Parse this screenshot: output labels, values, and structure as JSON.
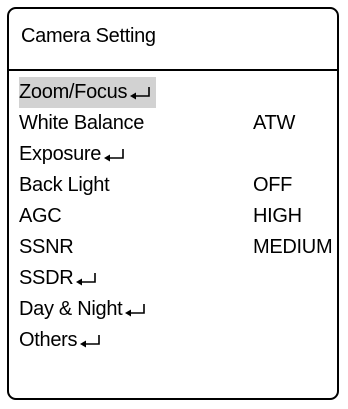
{
  "title": "Camera Setting",
  "menu": [
    {
      "label": "Zoom/Focus",
      "value": "",
      "submenu": true,
      "highlighted": true
    },
    {
      "label": "White Balance",
      "value": "ATW",
      "submenu": false,
      "highlighted": false
    },
    {
      "label": "Exposure",
      "value": "",
      "submenu": true,
      "highlighted": false
    },
    {
      "label": "Back Light",
      "value": "OFF",
      "submenu": false,
      "highlighted": false
    },
    {
      "label": "AGC",
      "value": "HIGH",
      "submenu": false,
      "highlighted": false
    },
    {
      "label": "SSNR",
      "value": "MEDIUM",
      "submenu": false,
      "highlighted": false
    },
    {
      "label": "SSDR",
      "value": "",
      "submenu": true,
      "highlighted": false
    },
    {
      "label": "Day & Night",
      "value": "",
      "submenu": true,
      "highlighted": false
    },
    {
      "label": "Others",
      "value": "",
      "submenu": true,
      "highlighted": false
    }
  ],
  "icons": {
    "submenu": "enter-arrow-icon"
  }
}
